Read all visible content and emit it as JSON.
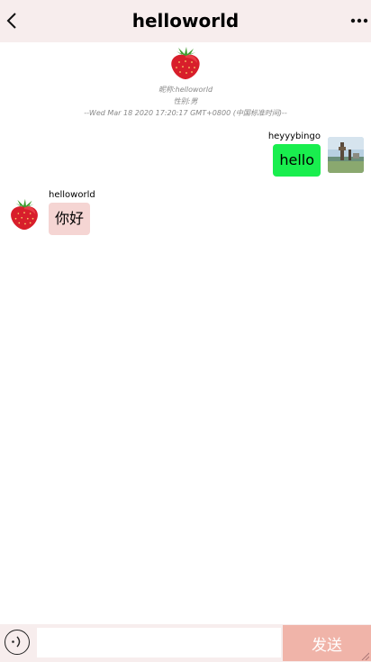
{
  "header": {
    "back_icon": "chevron-left-icon",
    "title": "helloworld",
    "more_icon": "ellipsis-icon"
  },
  "profile": {
    "avatar_icon": "strawberry-avatar",
    "nickname": "昵称:helloworld",
    "gender": "性别:男",
    "timestamp": "--Wed Mar 18 2020 17:20:17 GMT+0800 (中国标准时间)--"
  },
  "messages": [
    {
      "sender": "heyyybingo",
      "text": "hello",
      "side": "right",
      "bubble_color": "#19ee4e",
      "avatar_icon": "landscape-photo-avatar"
    },
    {
      "sender": "helloworld",
      "text": "你好",
      "side": "left",
      "bubble_color": "#f5d5d3",
      "avatar_icon": "strawberry-avatar"
    }
  ],
  "footer": {
    "emoji_icon": "emoji-face-icon",
    "input_value": "",
    "send_label": "发送",
    "send_color": "#f0b4a9"
  },
  "colors": {
    "header_bg": "#f7eded",
    "footer_bg": "#f7eded"
  }
}
